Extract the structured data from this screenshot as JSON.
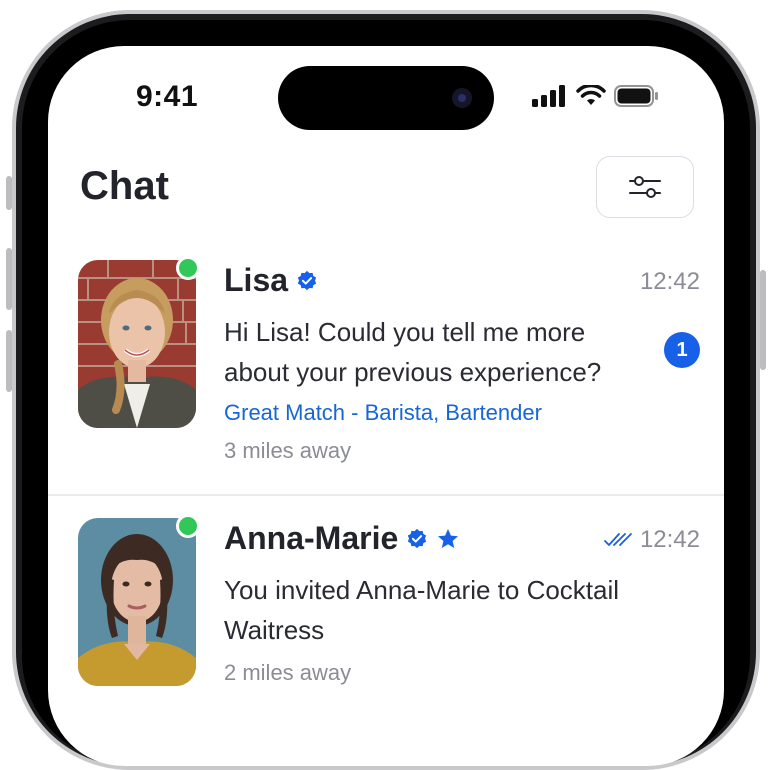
{
  "status_bar": {
    "time": "9:41"
  },
  "header": {
    "title": "Chat"
  },
  "colors": {
    "accent": "#1661e8",
    "online": "#32c759",
    "link": "#1766d6",
    "muted": "#8b8c96"
  },
  "chats": [
    {
      "name": "Lisa",
      "verified": true,
      "starred": false,
      "time": "12:42",
      "read_receipt": false,
      "message": "Hi Lisa! Could you tell me more about your previous experience?",
      "match": "Great Match - Barista, Bartender",
      "distance": "3 miles away",
      "unread": "1",
      "online": true
    },
    {
      "name": "Anna-Marie",
      "verified": true,
      "starred": true,
      "time": "12:42",
      "read_receipt": true,
      "message": "You invited Anna-Marie to Cocktail Waitress",
      "distance": "2 miles away",
      "online": true
    }
  ]
}
